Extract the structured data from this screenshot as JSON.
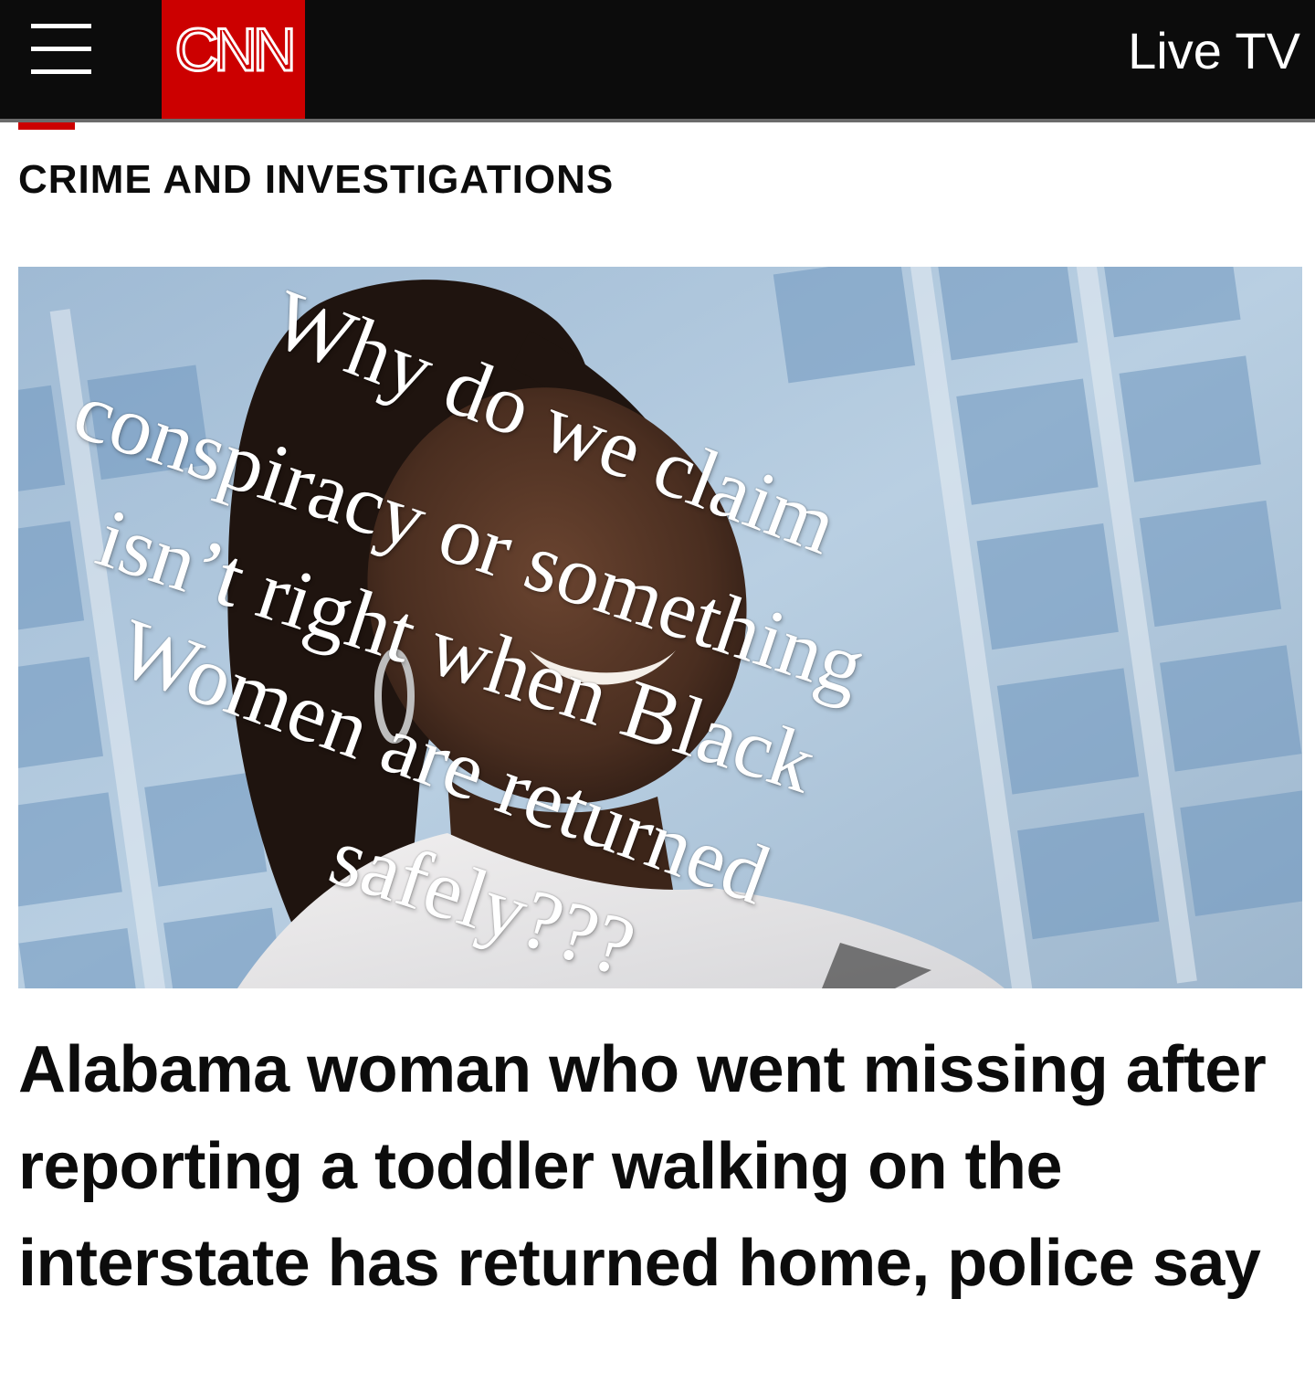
{
  "header": {
    "logo_text": "CNN",
    "live_tv_label": "Live TV"
  },
  "section": {
    "label": "CRIME AND INVESTIGATIONS"
  },
  "hero": {
    "overlay_lines": [
      "Why do we claim",
      "conspiracy or something",
      "isn’t right when Black",
      "Women are returned",
      "safely???"
    ]
  },
  "article": {
    "headline": "Alabama woman who went missing after reporting a toddler walking on the interstate has returned home, police say"
  },
  "colors": {
    "brand_red": "#cc0000",
    "topbar": "#0c0c0c",
    "text": "#0c0c0c"
  }
}
